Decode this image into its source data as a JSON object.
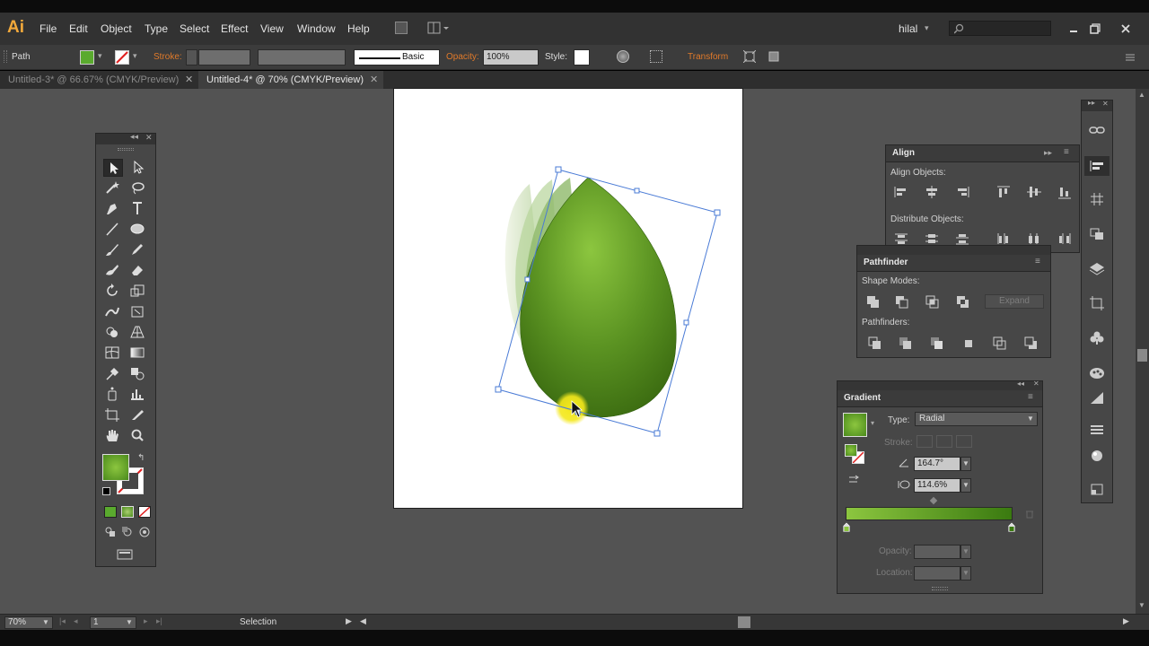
{
  "app": {
    "logo": "Ai"
  },
  "menu": [
    "File",
    "Edit",
    "Object",
    "Type",
    "Select",
    "Effect",
    "View",
    "Window",
    "Help"
  ],
  "user": {
    "name": "hilal"
  },
  "control_bar": {
    "object_type": "Path",
    "stroke_label": "Stroke:",
    "brush_label": "Basic",
    "opacity_label": "Opacity:",
    "opacity_value": "100%",
    "style_label": "Style:",
    "transform_label": "Transform"
  },
  "tabs": [
    {
      "label": "Untitled-3* @ 66.67% (CMYK/Preview)",
      "active": false
    },
    {
      "label": "Untitled-4* @ 70% (CMYK/Preview)",
      "active": true
    }
  ],
  "align_panel": {
    "title": "Align",
    "align_objects_label": "Align Objects:",
    "distribute_objects_label": "Distribute Objects:"
  },
  "pathfinder_panel": {
    "title": "Pathfinder",
    "shape_modes_label": "Shape Modes:",
    "expand_label": "Expand",
    "pathfinders_label": "Pathfinders:"
  },
  "gradient_panel": {
    "title": "Gradient",
    "type_label": "Type:",
    "type_value": "Radial",
    "stroke_label": "Stroke:",
    "angle_value": "164.7°",
    "aspect_value": "114.6%",
    "opacity_label": "Opacity:",
    "location_label": "Location:"
  },
  "status": {
    "zoom": "70%",
    "page": "1",
    "tool": "Selection"
  },
  "colors": {
    "accent_orange": "#f2a93b",
    "leaf_light": "#8cc63f",
    "leaf_dark": "#3a6a10",
    "highlight_yellow": "#f4e81c",
    "selection_blue": "#4a7bd6"
  }
}
